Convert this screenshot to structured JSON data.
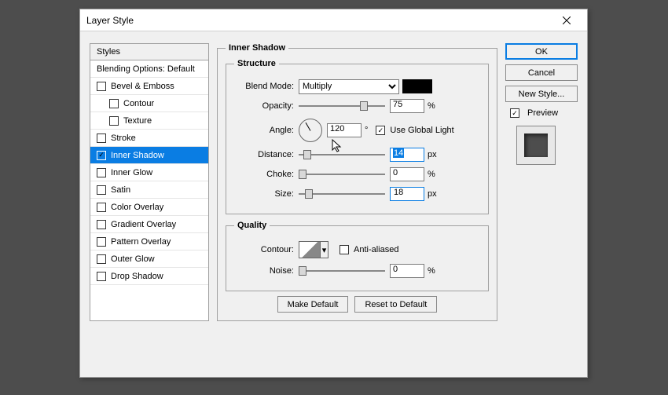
{
  "dialog": {
    "title": "Layer Style"
  },
  "styles": {
    "header": "Styles",
    "blending": "Blending Options: Default",
    "items": [
      {
        "label": "Bevel & Emboss",
        "checked": false,
        "indent": false
      },
      {
        "label": "Contour",
        "checked": false,
        "indent": true
      },
      {
        "label": "Texture",
        "checked": false,
        "indent": true
      },
      {
        "label": "Stroke",
        "checked": false,
        "indent": false
      },
      {
        "label": "Inner Shadow",
        "checked": true,
        "indent": false,
        "selected": true
      },
      {
        "label": "Inner Glow",
        "checked": false,
        "indent": false
      },
      {
        "label": "Satin",
        "checked": false,
        "indent": false
      },
      {
        "label": "Color Overlay",
        "checked": false,
        "indent": false
      },
      {
        "label": "Gradient Overlay",
        "checked": false,
        "indent": false
      },
      {
        "label": "Pattern Overlay",
        "checked": false,
        "indent": false
      },
      {
        "label": "Outer Glow",
        "checked": false,
        "indent": false
      },
      {
        "label": "Drop Shadow",
        "checked": false,
        "indent": false
      }
    ]
  },
  "effect": {
    "title": "Inner Shadow",
    "structure": {
      "legend": "Structure",
      "blend_mode_label": "Blend Mode:",
      "blend_mode_value": "Multiply",
      "color": "#000000",
      "opacity_label": "Opacity:",
      "opacity_value": "75",
      "opacity_unit": "%",
      "angle_label": "Angle:",
      "angle_value": "120",
      "angle_unit": "°",
      "global_light_label": "Use Global Light",
      "global_light_checked": true,
      "distance_label": "Distance:",
      "distance_value": "14",
      "distance_unit": "px",
      "choke_label": "Choke:",
      "choke_value": "0",
      "choke_unit": "%",
      "size_label": "Size:",
      "size_value": "18",
      "size_unit": "px"
    },
    "quality": {
      "legend": "Quality",
      "contour_label": "Contour:",
      "antialiased_label": "Anti-aliased",
      "antialiased_checked": false,
      "noise_label": "Noise:",
      "noise_value": "0",
      "noise_unit": "%"
    },
    "buttons": {
      "make_default": "Make Default",
      "reset": "Reset to Default"
    }
  },
  "actions": {
    "ok": "OK",
    "cancel": "Cancel",
    "new_style": "New Style...",
    "preview_label": "Preview",
    "preview_checked": true
  }
}
